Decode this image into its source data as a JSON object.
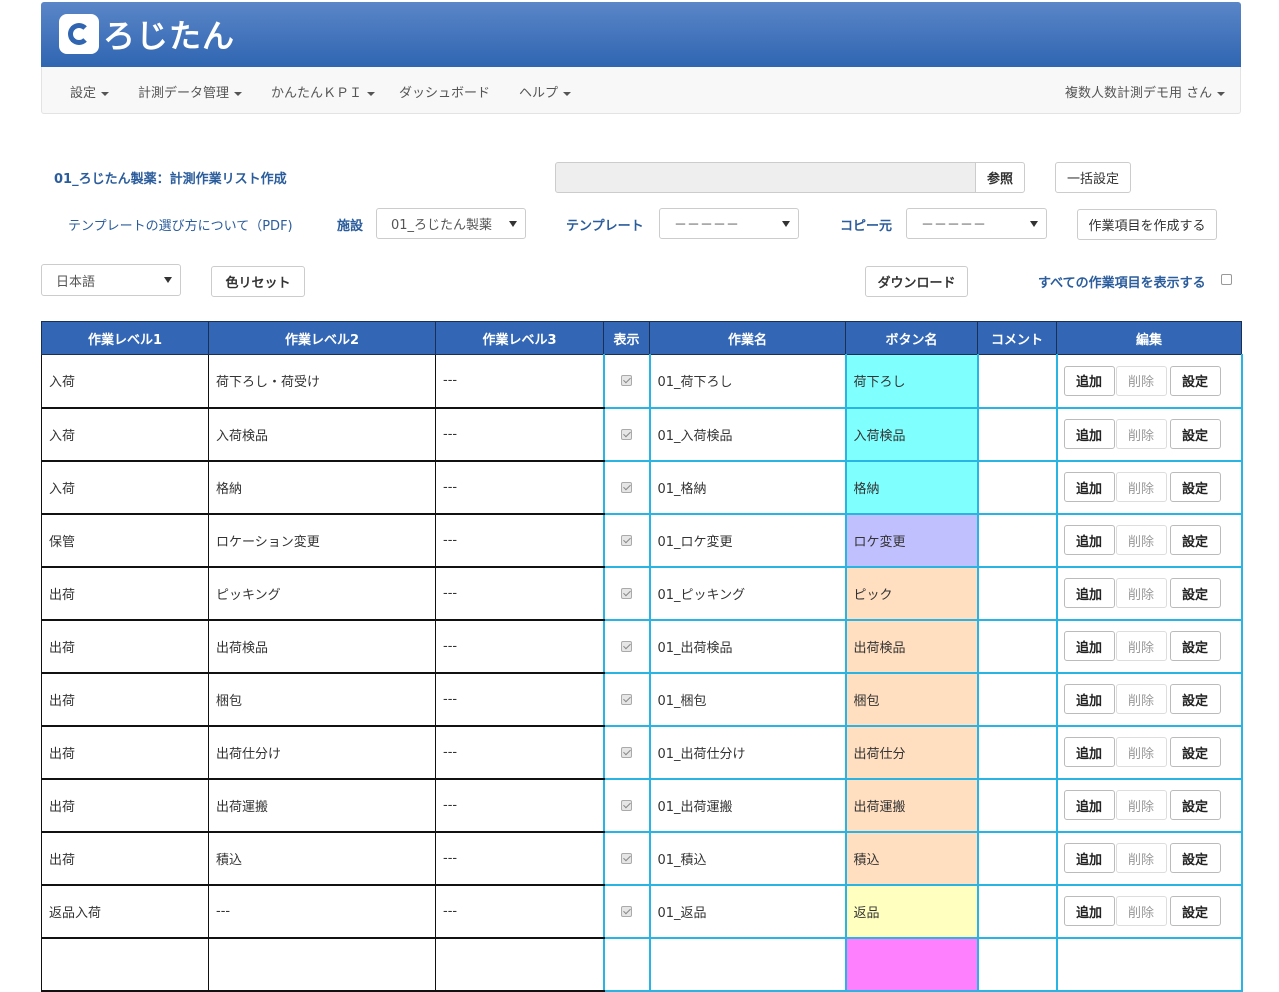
{
  "header": {
    "logo_text": "ろじたん",
    "colors": {
      "banner_top": "#5b86c8",
      "banner_bottom": "#2f65b1",
      "table_header": "#3367b5",
      "accent_border": "#2ab4e3"
    }
  },
  "nav": {
    "items": [
      "設定",
      "計測データ管理",
      "かんたんＫＰＩ",
      "ダッシュボード",
      "ヘルプ"
    ],
    "user": "複数人数計測デモ用 さん"
  },
  "toolbar": {
    "page_title": "01_ろじたん製薬：計測作業リスト作成",
    "browse_label": "参照",
    "bulk_set_label": "一括設定",
    "pdf_link": "テンプレートの選び方について（PDF)",
    "facility_label": "施設",
    "facility_value": "01_ろじたん製薬",
    "template_label": "テンプレート",
    "template_value": "－－－－－",
    "copy_label": "コピー元",
    "copy_value": "－－－－－",
    "create_items_label": "作業項目を作成する",
    "language_value": "日本語",
    "color_reset_label": "色リセット",
    "download_label": "ダウンロード",
    "show_all_label": "すべての作業項目を表示する"
  },
  "table": {
    "headers": [
      "作業レベル1",
      "作業レベル2",
      "作業レベル3",
      "表示",
      "作業名",
      "ボタン名",
      "コメント",
      "編集"
    ],
    "edit_buttons": {
      "add": "追加",
      "delete": "削除",
      "settings": "設定"
    },
    "rows": [
      {
        "l1": "入荷",
        "l2": "荷下ろし・荷受け",
        "l3": "---",
        "name": "01_荷下ろし",
        "button": "荷下ろし",
        "color": "#80ffff",
        "comment": ""
      },
      {
        "l1": "入荷",
        "l2": "入荷検品",
        "l3": "---",
        "name": "01_入荷検品",
        "button": "入荷検品",
        "color": "#80ffff",
        "comment": ""
      },
      {
        "l1": "入荷",
        "l2": "格納",
        "l3": "---",
        "name": "01_格納",
        "button": "格納",
        "color": "#80ffff",
        "comment": ""
      },
      {
        "l1": "保管",
        "l2": "ロケーション変更",
        "l3": "---",
        "name": "01_ロケ変更",
        "button": "ロケ変更",
        "color": "#c0c0ff",
        "comment": ""
      },
      {
        "l1": "出荷",
        "l2": "ピッキング",
        "l3": "---",
        "name": "01_ピッキング",
        "button": "ピック",
        "color": "#ffdfc0",
        "comment": ""
      },
      {
        "l1": "出荷",
        "l2": "出荷検品",
        "l3": "---",
        "name": "01_出荷検品",
        "button": "出荷検品",
        "color": "#ffdfc0",
        "comment": ""
      },
      {
        "l1": "出荷",
        "l2": "梱包",
        "l3": "---",
        "name": "01_梱包",
        "button": "梱包",
        "color": "#ffdfc0",
        "comment": ""
      },
      {
        "l1": "出荷",
        "l2": "出荷仕分け",
        "l3": "---",
        "name": "01_出荷仕分け",
        "button": "出荷仕分",
        "color": "#ffdfc0",
        "comment": ""
      },
      {
        "l1": "出荷",
        "l2": "出荷運搬",
        "l3": "---",
        "name": "01_出荷運搬",
        "button": "出荷運搬",
        "color": "#ffdfc0",
        "comment": ""
      },
      {
        "l1": "出荷",
        "l2": "積込",
        "l3": "---",
        "name": "01_積込",
        "button": "積込",
        "color": "#ffdfc0",
        "comment": ""
      },
      {
        "l1": "返品入荷",
        "l2": "---",
        "l3": "---",
        "name": "01_返品",
        "button": "返品",
        "color": "#ffffc0",
        "comment": ""
      },
      {
        "l1": "",
        "l2": "",
        "l3": "",
        "name": "",
        "button": "",
        "color": "#ff80ff",
        "comment": ""
      }
    ]
  }
}
